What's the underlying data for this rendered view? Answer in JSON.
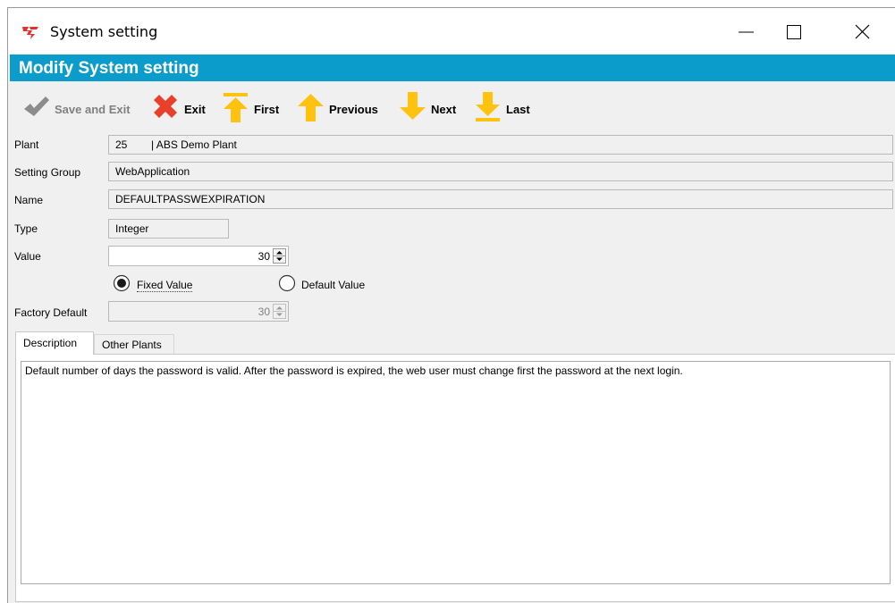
{
  "window": {
    "title": "System setting",
    "icon": "app-logo-icon",
    "controls": [
      "minimize-icon",
      "maximize-icon",
      "close-icon"
    ]
  },
  "header": {
    "title": "Modify System setting",
    "color": "#0c9ccb"
  },
  "toolbar": {
    "save_exit": "Save and Exit",
    "exit": "Exit",
    "first": "First",
    "previous": "Previous",
    "next": "Next",
    "last": "Last"
  },
  "form": {
    "plant_label": "Plant",
    "plant_value": "25        | ABS Demo Plant",
    "group_label": "Setting Group",
    "group_value": "WebApplication",
    "name_label": "Name",
    "name_value": "DEFAULTPASSWEXPIRATION",
    "type_label": "Type",
    "type_value": "Integer",
    "value_label": "Value",
    "value_value": "30",
    "fixed_label": "Fixed Value",
    "default_label": "Default Value",
    "selected_mode": "Fixed Value",
    "factory_label": "Factory Default",
    "factory_value": "30"
  },
  "tabs": {
    "description": "Description",
    "other_plants": "Other Plants",
    "active": "Description"
  },
  "description_text": "Default number of days the password is valid. After the password is expired, the web user must change first the password at the next login.",
  "colors": {
    "arrow_yellow": "#ffc20e",
    "exit_red": "#e8402a",
    "disabled_gray": "#808080"
  }
}
